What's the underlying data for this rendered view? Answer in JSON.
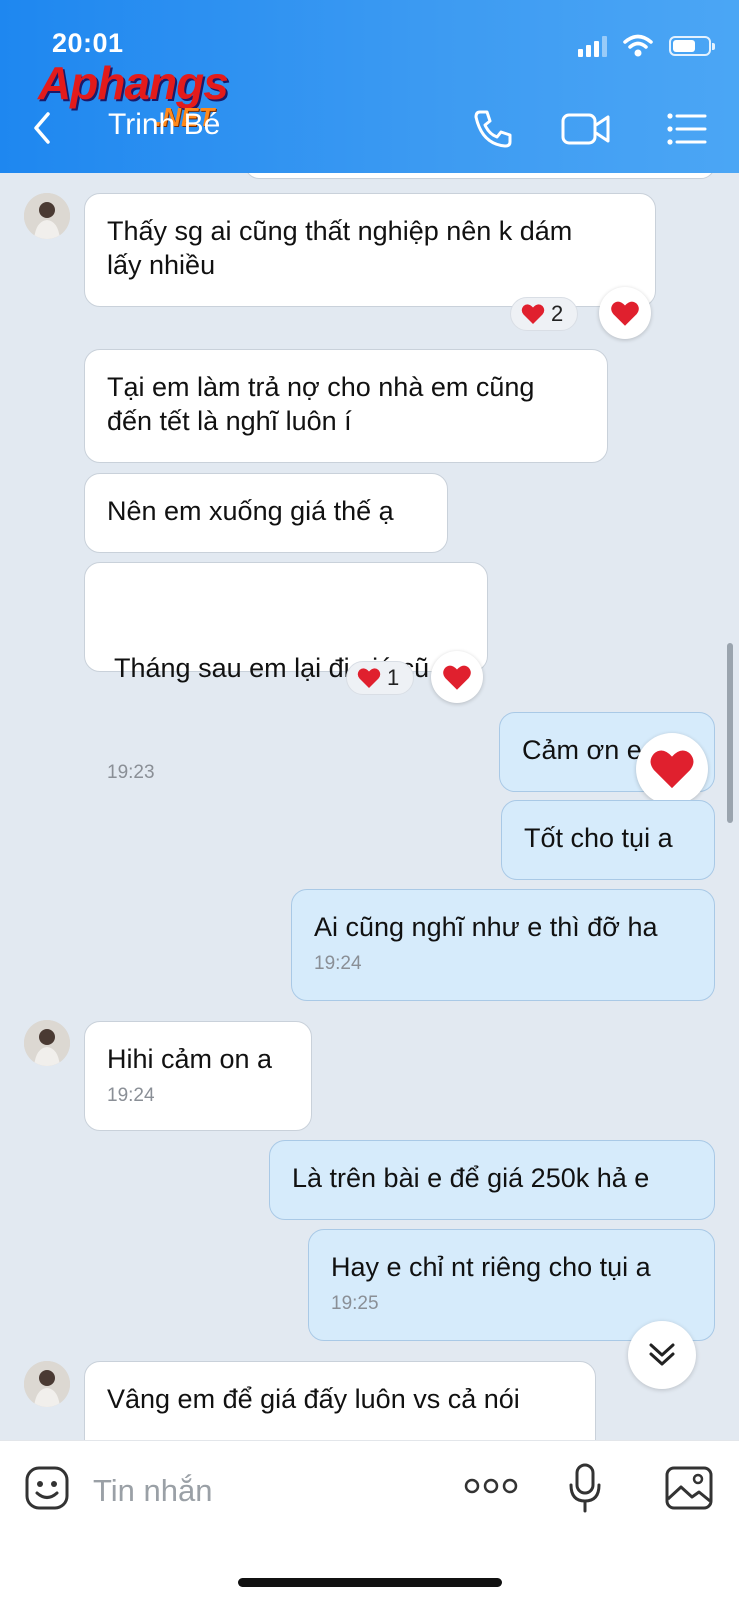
{
  "status_bar": {
    "time": "20:01"
  },
  "watermark": {
    "main": "Aphangs",
    "sub": ".NET"
  },
  "header": {
    "title": "Trinh Bé"
  },
  "messages": [
    {
      "side": "in",
      "lines": [
        "Thấy sg ai cũng thất nghiệp nên k dám",
        "lấy nhiều"
      ],
      "time": "",
      "reaction_count": "2"
    },
    {
      "side": "in",
      "lines": [
        "Tại em làm trả nợ cho nhà em cũng",
        "đến tết là nghĩ luôn í"
      ],
      "time": ""
    },
    {
      "side": "in",
      "lines": [
        "Nên em xuống giá thế ạ"
      ],
      "time": ""
    },
    {
      "side": "in",
      "lines": [
        " Tháng sau em lại đi giá cũ"
      ],
      "time": "19:23",
      "reaction_count": "1"
    },
    {
      "side": "out",
      "lines": [
        "Cảm ơn e"
      ],
      "time": ""
    },
    {
      "side": "out",
      "lines": [
        "Tốt cho tụi a"
      ],
      "time": ""
    },
    {
      "side": "out",
      "lines": [
        "Ai cũng nghĩ như e thì đỡ ha"
      ],
      "time": "19:24"
    },
    {
      "side": "in",
      "lines": [
        "Hihi cảm on a"
      ],
      "time": "19:24"
    },
    {
      "side": "out",
      "lines": [
        "Là trên bài e để giá 250k hả e"
      ],
      "time": ""
    },
    {
      "side": "out",
      "lines": [
        "Hay e chỉ nt riêng cho tụi a"
      ],
      "time": "19:25"
    },
    {
      "side": "in",
      "lines": [
        "Vâng em để giá đấy luôn vs cả nói"
      ],
      "time": ""
    }
  ],
  "composer": {
    "placeholder": "Tin nhắn"
  },
  "colors": {
    "header": "#1e87f0",
    "incoming": "#ffffff",
    "outgoing": "#d6ebfb",
    "heart": "#e0202e"
  }
}
